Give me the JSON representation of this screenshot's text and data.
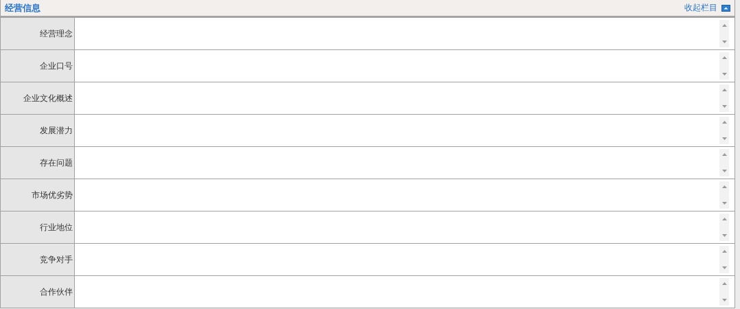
{
  "panel": {
    "title": "经营信息",
    "collapse_link": "收起栏目"
  },
  "fields": [
    {
      "label": "经营理念"
    },
    {
      "label": "企业口号"
    },
    {
      "label": "企业文化概述"
    },
    {
      "label": "发展潜力"
    },
    {
      "label": "存在问题"
    },
    {
      "label": "市场优劣势"
    },
    {
      "label": "行业地位"
    },
    {
      "label": "竞争对手"
    },
    {
      "label": "合作伙伴"
    }
  ]
}
